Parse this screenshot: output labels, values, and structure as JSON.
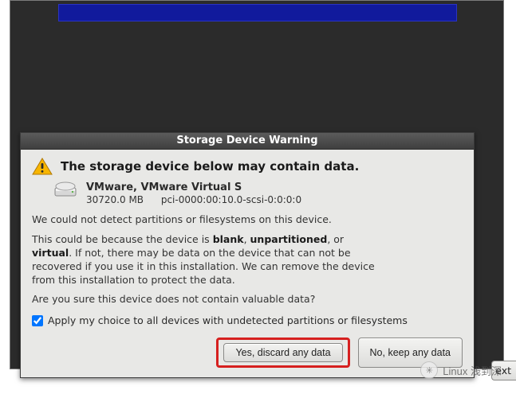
{
  "dialog": {
    "title": "Storage Device Warning",
    "headline": "The storage device below may contain data.",
    "device": {
      "name": "VMware, VMware Virtual S",
      "size": "30720.0 MB",
      "path": "pci-0000:00:10.0-scsi-0:0:0:0"
    },
    "para1": "We could not detect partitions or filesystems on this device.",
    "para2_pre": "This could be because the device is ",
    "para2_b1": "blank",
    "para2_mid1": ", ",
    "para2_b2": "unpartitioned",
    "para2_mid2": ", or ",
    "para2_b3": "virtual",
    "para2_post": ". If not, there may be data on the device that can not be recovered if you use it in this installation. We can remove the device from this installation to protect the data.",
    "para3": "Are you sure this device does not contain valuable data?",
    "checkbox_label": "Apply my choice to all devices with undetected partitions or filesystems",
    "checkbox_checked": true,
    "btn_discard": "Yes, discard any data",
    "btn_keep": "No, keep any data"
  },
  "nav": {
    "next": "ext"
  },
  "watermark": {
    "icon": "✳",
    "text": "Linux 浅到深"
  }
}
